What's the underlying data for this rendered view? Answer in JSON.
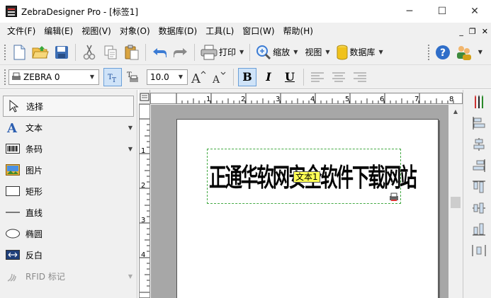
{
  "window": {
    "title": "ZebraDesigner Pro - [标签1]",
    "controls": {
      "minimize": "─",
      "maximize": "☐",
      "close": "✕"
    }
  },
  "menu": {
    "items": [
      "文件(F)",
      "编辑(E)",
      "视图(V)",
      "对象(O)",
      "数据库(D)",
      "工具(L)",
      "窗口(W)",
      "帮助(H)"
    ],
    "mdi_controls": [
      "_",
      "❐",
      "✕"
    ]
  },
  "toolbar": {
    "print_label": "打印",
    "zoom_label": "缩放",
    "view_label": "视图",
    "database_label": "数据库"
  },
  "format": {
    "printer_font": "ZEBRA 0",
    "font_size": "10.0",
    "bold": "B",
    "italic": "I",
    "underline": "U"
  },
  "tools": {
    "items": [
      {
        "label": "选择",
        "icon": "pointer-icon",
        "selected": true,
        "has_arrow": false
      },
      {
        "label": "文本",
        "icon": "text-icon",
        "has_arrow": true
      },
      {
        "label": "条码",
        "icon": "barcode-icon",
        "has_arrow": true
      },
      {
        "label": "图片",
        "icon": "picture-icon",
        "has_arrow": false
      },
      {
        "label": "矩形",
        "icon": "rectangle-icon",
        "has_arrow": false
      },
      {
        "label": "直线",
        "icon": "line-icon",
        "has_arrow": false
      },
      {
        "label": "椭圆",
        "icon": "ellipse-icon",
        "has_arrow": false
      },
      {
        "label": "反白",
        "icon": "inverse-icon",
        "has_arrow": false
      },
      {
        "label": "RFID 标记",
        "icon": "rfid-icon",
        "has_arrow": true,
        "disabled": true
      }
    ]
  },
  "ruler": {
    "h_numbers": [
      "1",
      "2",
      "3",
      "4",
      "5",
      "6",
      "7",
      "8"
    ],
    "v_numbers": [
      "1",
      "2",
      "3",
      "4"
    ]
  },
  "label": {
    "text": "正通华软网安全软件下载网站",
    "object_tag": "文本1"
  }
}
